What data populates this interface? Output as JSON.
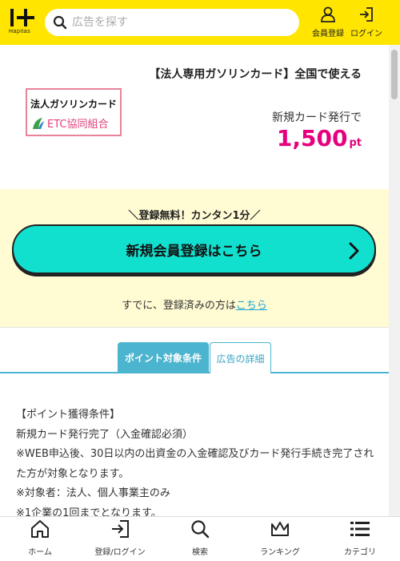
{
  "header": {
    "logo_text": "Hapitas",
    "search_placeholder": "広告を探す",
    "register_label": "会員登録",
    "login_label": "ログイン"
  },
  "ad": {
    "title": "【法人専用ガソリンカード】全国で使える",
    "logo_line1": "法人ガソリンカード",
    "logo_line2": "ETC協同組合",
    "issue_label": "新規カード発行で",
    "points_value": "1,500",
    "points_unit": "pt"
  },
  "register": {
    "tagline": "＼登録無料！カンタン1分／",
    "button_label": "新規会員登録はこちら",
    "already_text": "すでに、登録済みの方は",
    "already_link": "こちら"
  },
  "tabs": [
    {
      "label": "ポイント対象条件",
      "active": true
    },
    {
      "label": "広告の詳細",
      "active": false
    }
  ],
  "conditions": [
    "【ポイント獲得条件】",
    "新規カード発行完了（入金確認必須）",
    "※WEB申込後、30日以内の出資金の入金確認及びカード発行手続き完了された方が対象となります。",
    "※対象者：法人、個人事業主のみ",
    "※1企業の1回までとなります。"
  ],
  "bottom_nav": [
    {
      "label": "ホーム",
      "icon": "home-icon"
    },
    {
      "label": "登録/ログイン",
      "icon": "login-icon"
    },
    {
      "label": "検索",
      "icon": "search-icon"
    },
    {
      "label": "ランキング",
      "icon": "crown-icon"
    },
    {
      "label": "カテゴリ",
      "icon": "list-icon"
    }
  ],
  "colors": {
    "header_bg": "#ffe500",
    "points": "#e6007e",
    "register_button": "#12e0cf",
    "register_band": "#fffbd3",
    "tab_active": "#4bb4cf",
    "link": "#1aa3d6"
  }
}
